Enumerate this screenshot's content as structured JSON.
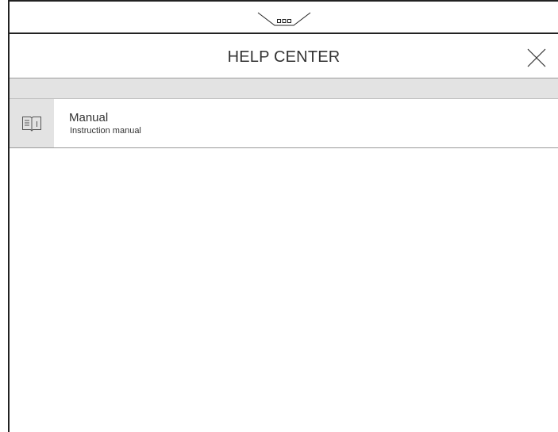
{
  "drawer": {
    "handle_icon": "more-horizontal-icon"
  },
  "header": {
    "title": "HELP CENTER",
    "close_icon": "close-icon"
  },
  "help_items": [
    {
      "icon": "book-icon",
      "title": "Manual",
      "subtitle": "Instruction manual"
    }
  ],
  "colors": {
    "frame": "#222222",
    "text": "#333333",
    "band": "#e3e3e3",
    "divider": "#9a9a9a"
  }
}
